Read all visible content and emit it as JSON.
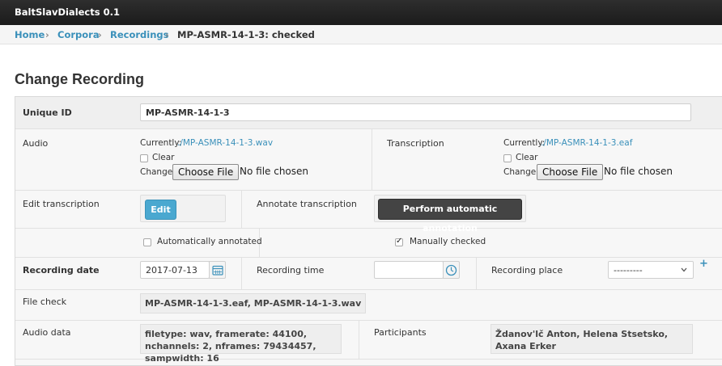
{
  "app": {
    "title": "BaltSlavDialects 0.1"
  },
  "breadcrumb": {
    "items": [
      "Home",
      "Corpora",
      "Recordings"
    ],
    "current": "MP-ASMR-14-1-3: checked",
    "separator": "›"
  },
  "page": {
    "title": "Change Recording"
  },
  "form": {
    "unique_id": {
      "label": "Unique ID",
      "value": "MP-ASMR-14-1-3"
    },
    "audio": {
      "label": "Audio",
      "currently_label": "Currently:",
      "current_file": "./MP-ASMR-14-1-3.wav",
      "clear_label": "Clear",
      "change_label": "Change:",
      "choose_label": "Choose File",
      "no_file_label": "No file chosen"
    },
    "transcription": {
      "label": "Transcription",
      "currently_label": "Currently:",
      "current_file": "./MP-ASMR-14-1-3.eaf",
      "clear_label": "Clear",
      "change_label": "Change:",
      "choose_label": "Choose File",
      "no_file_label": "No file chosen"
    },
    "edit_transcription": {
      "label": "Edit transcription",
      "button": "Edit"
    },
    "annotate_transcription": {
      "label": "Annotate transcription",
      "button": "Perform automatic annotation"
    },
    "automatically_annotated": {
      "label": "Automatically annotated",
      "checked": false
    },
    "manually_checked": {
      "label": "Manually checked",
      "checked": true
    },
    "recording_date": {
      "label": "Recording date",
      "value": "2017-07-13"
    },
    "recording_time": {
      "label": "Recording time",
      "value": ""
    },
    "recording_place": {
      "label": "Recording place",
      "selected": "---------",
      "add_symbol": "+"
    },
    "file_check": {
      "label": "File check",
      "value": "MP-ASMR-14-1-3.eaf, MP-ASMR-14-1-3.wav"
    },
    "audio_data": {
      "label": "Audio data",
      "value": "filetype: wav, framerate: 44100, nchannels: 2, nframes: 79434457, sampwidth: 16"
    },
    "participants": {
      "label": "Participants",
      "value": "Ždanov'lč Anton, Helena Stsetsko, Axana Erker"
    }
  },
  "icons": {
    "calendar": "calendar-icon",
    "clock": "clock-icon",
    "chevron": "chevron-down-icon"
  },
  "colors": {
    "accent": "#3a90ba",
    "edit_button": "#4aa8d0",
    "dark_button": "#444444",
    "topbar": "#222222"
  }
}
